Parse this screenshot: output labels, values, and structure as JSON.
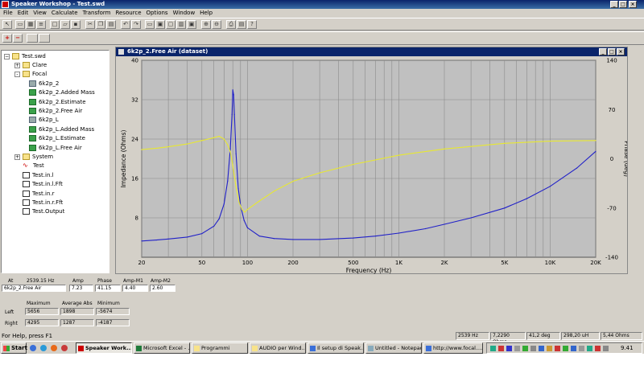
{
  "app": {
    "title": "Speaker Workshop - Test.swd"
  },
  "menu": [
    "File",
    "Edit",
    "View",
    "Calculate",
    "Transform",
    "Resource",
    "Options",
    "Window",
    "Help"
  ],
  "tree": {
    "root": "Test.swd",
    "items": [
      {
        "label": "Clare",
        "level": 1,
        "icon": "folder-icon",
        "expander": "+"
      },
      {
        "label": "Focal",
        "level": 1,
        "icon": "folder-icon",
        "expander": "-"
      },
      {
        "label": "6k2p_2",
        "level": 2,
        "icon": "speaker-icon"
      },
      {
        "label": "6k2p_2.Added Mass",
        "level": 2,
        "icon": "green-data-icon"
      },
      {
        "label": "6k2p_2.Estimate",
        "level": 2,
        "icon": "green-data-icon"
      },
      {
        "label": "6k2p_2.Free Air",
        "level": 2,
        "icon": "green-data-icon"
      },
      {
        "label": "6k2p_L",
        "level": 2,
        "icon": "speaker-icon"
      },
      {
        "label": "6k2p_L.Added Mass",
        "level": 2,
        "icon": "green-data-icon"
      },
      {
        "label": "6k2p_L.Estimate",
        "level": 2,
        "icon": "green-data-icon"
      },
      {
        "label": "6k2p_L.Free Air",
        "level": 2,
        "icon": "green-data-icon"
      },
      {
        "label": "System",
        "level": 1,
        "icon": "folder-icon",
        "expander": "+"
      },
      {
        "label": "Test",
        "level": 1,
        "icon": "wave-icon"
      },
      {
        "label": "Test.in.l",
        "level": 1,
        "icon": "doc-icon"
      },
      {
        "label": "Test.in.l.Fft",
        "level": 1,
        "icon": "doc-icon"
      },
      {
        "label": "Test.in.r",
        "level": 1,
        "icon": "doc-icon"
      },
      {
        "label": "Test.in.r.Fft",
        "level": 1,
        "icon": "doc-icon"
      },
      {
        "label": "Test.Output",
        "level": 1,
        "icon": "doc-icon"
      }
    ]
  },
  "chart_window": {
    "title": "6k2p_2.Free Air (dataset)"
  },
  "chart_data": {
    "type": "line",
    "xlabel": "Frequency (Hz)",
    "ylabel": "Impedance (Ohms)",
    "y2label": "Phase (deg)",
    "x_scale": "log",
    "xlim": [
      20,
      20000
    ],
    "ylim": [
      0,
      40
    ],
    "y2lim": [
      -140,
      140
    ],
    "x_ticks": [
      {
        "v": 20,
        "l": "20"
      },
      {
        "v": 50,
        "l": "50"
      },
      {
        "v": 100,
        "l": "100"
      },
      {
        "v": 200,
        "l": "200"
      },
      {
        "v": 500,
        "l": "500"
      },
      {
        "v": 1000,
        "l": "1K"
      },
      {
        "v": 2000,
        "l": "2K"
      },
      {
        "v": 5000,
        "l": "5K"
      },
      {
        "v": 10000,
        "l": "10K"
      },
      {
        "v": 20000,
        "l": "20K"
      }
    ],
    "y_ticks": [
      {
        "v": 8,
        "l": "8"
      },
      {
        "v": 16,
        "l": "16"
      },
      {
        "v": 24,
        "l": "24"
      },
      {
        "v": 32,
        "l": "32"
      },
      {
        "v": 40,
        "l": "40"
      }
    ],
    "y2_ticks": [
      {
        "v": -140,
        "l": "-140"
      },
      {
        "v": -70,
        "l": "-70"
      },
      {
        "v": 0,
        "l": "0"
      },
      {
        "v": 70,
        "l": "70"
      },
      {
        "v": 140,
        "l": "140"
      }
    ],
    "grid": true,
    "colors": {
      "impedance": "#2020c8",
      "phase": "#e8e830",
      "plot_bg": "#c0c0c0"
    },
    "series": [
      {
        "axis": "y",
        "color": "#2020c8",
        "x": [
          20,
          25,
          30,
          40,
          50,
          60,
          65,
          70,
          74,
          77,
          79,
          80,
          81,
          82,
          84,
          87,
          90,
          95,
          100,
          120,
          150,
          200,
          300,
          500,
          700,
          1000,
          1500,
          2000,
          3000,
          5000,
          7000,
          10000,
          15000,
          20000
        ],
        "y": [
          3.3,
          3.5,
          3.7,
          4.1,
          4.8,
          6.3,
          7.8,
          10.8,
          15.5,
          22,
          29,
          34,
          33,
          29,
          21,
          14,
          10.5,
          7.5,
          6,
          4.3,
          3.8,
          3.6,
          3.6,
          3.9,
          4.3,
          4.9,
          5.8,
          6.7,
          8.0,
          10.0,
          11.9,
          14.4,
          18.1,
          21.5
        ]
      },
      {
        "axis": "y2",
        "color": "#e8e830",
        "x": [
          20,
          25,
          30,
          40,
          50,
          60,
          65,
          70,
          74,
          77,
          80,
          84,
          88,
          92,
          96,
          100,
          120,
          150,
          200,
          300,
          500,
          1000,
          2000,
          5000,
          10000,
          20000
        ],
        "y": [
          13,
          15,
          17,
          21,
          26,
          30,
          32,
          28,
          20,
          10,
          -10,
          -40,
          -62,
          -72,
          -76,
          -72,
          -60,
          -46,
          -32,
          -20,
          -8,
          5,
          14,
          22,
          25,
          26
        ]
      }
    ]
  },
  "readout": {
    "headers": {
      "at": "At",
      "at_value": "2539.15 Hz",
      "amp": "Amp",
      "phase": "Phase",
      "amp_m1": "Amp-M1",
      "amp_m2": "Amp-M2"
    },
    "row": {
      "name": "6k2p_2.Free Air",
      "amp": "7.23",
      "phase": "41.15",
      "amp_m1": "4.40",
      "amp_m2": "2.60"
    },
    "stats_headers": {
      "maximum": "Maximum",
      "average_abs": "Average Abs",
      "minimum": "Minimum"
    },
    "left": {
      "label": "Left",
      "maximum": "5656",
      "average_abs": "1898",
      "minimum": "-5674"
    },
    "right": {
      "label": "Right",
      "maximum": "4295",
      "average_abs": "1287",
      "minimum": "-4187"
    }
  },
  "status": {
    "help": "For Help, press F1",
    "freq": "2539 Hz",
    "ohms": "7,2290 Ohms",
    "deg": "41,2 deg",
    "uh": "298,20 uH",
    "ohms2": "5,44 Ohms"
  },
  "taskbar": {
    "start": "Start",
    "tasks": [
      "Speaker Work...",
      "Microsoft Excel - ...",
      "Programmi",
      "AUDIO per Wind...",
      "Il setup di Speak...",
      "Untitled - Notepad",
      "http://www.focal...."
    ],
    "clock": "9.41"
  }
}
